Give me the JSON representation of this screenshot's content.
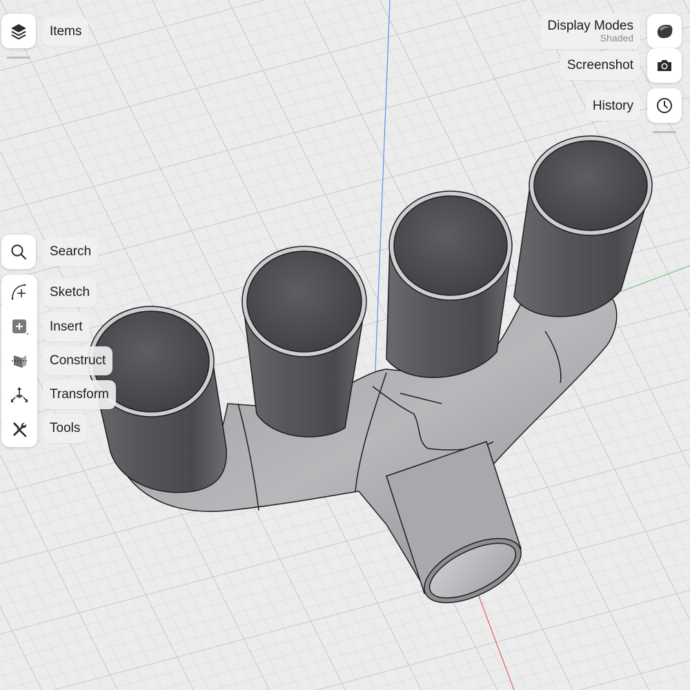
{
  "top_left": {
    "items_label": "Items",
    "items_icon": "layers-icon"
  },
  "top_right": {
    "display_modes_label": "Display Modes",
    "display_modes_value": "Shaded",
    "display_modes_icon": "shaded-cube-icon",
    "screenshot_label": "Screenshot",
    "screenshot_icon": "camera-icon",
    "history_label": "History",
    "history_icon": "clock-icon"
  },
  "left_toolbar": {
    "search_label": "Search",
    "search_icon": "search-icon",
    "tools": [
      {
        "label": "Sketch",
        "icon": "sketch-icon"
      },
      {
        "label": "Insert",
        "icon": "insert-plus-icon"
      },
      {
        "label": "Construct",
        "icon": "construct-plane-icon"
      },
      {
        "label": "Transform",
        "icon": "transform-axes-icon"
      },
      {
        "label": "Tools",
        "icon": "wrench-screwdriver-icon"
      }
    ]
  },
  "viewport": {
    "model": "exhaust-manifold",
    "axis_colors": {
      "y": "#5b8fe6",
      "x": "#e06060",
      "z": "#6fc27a"
    },
    "grid_color": "#c9c9cc",
    "background": "#ececed"
  }
}
